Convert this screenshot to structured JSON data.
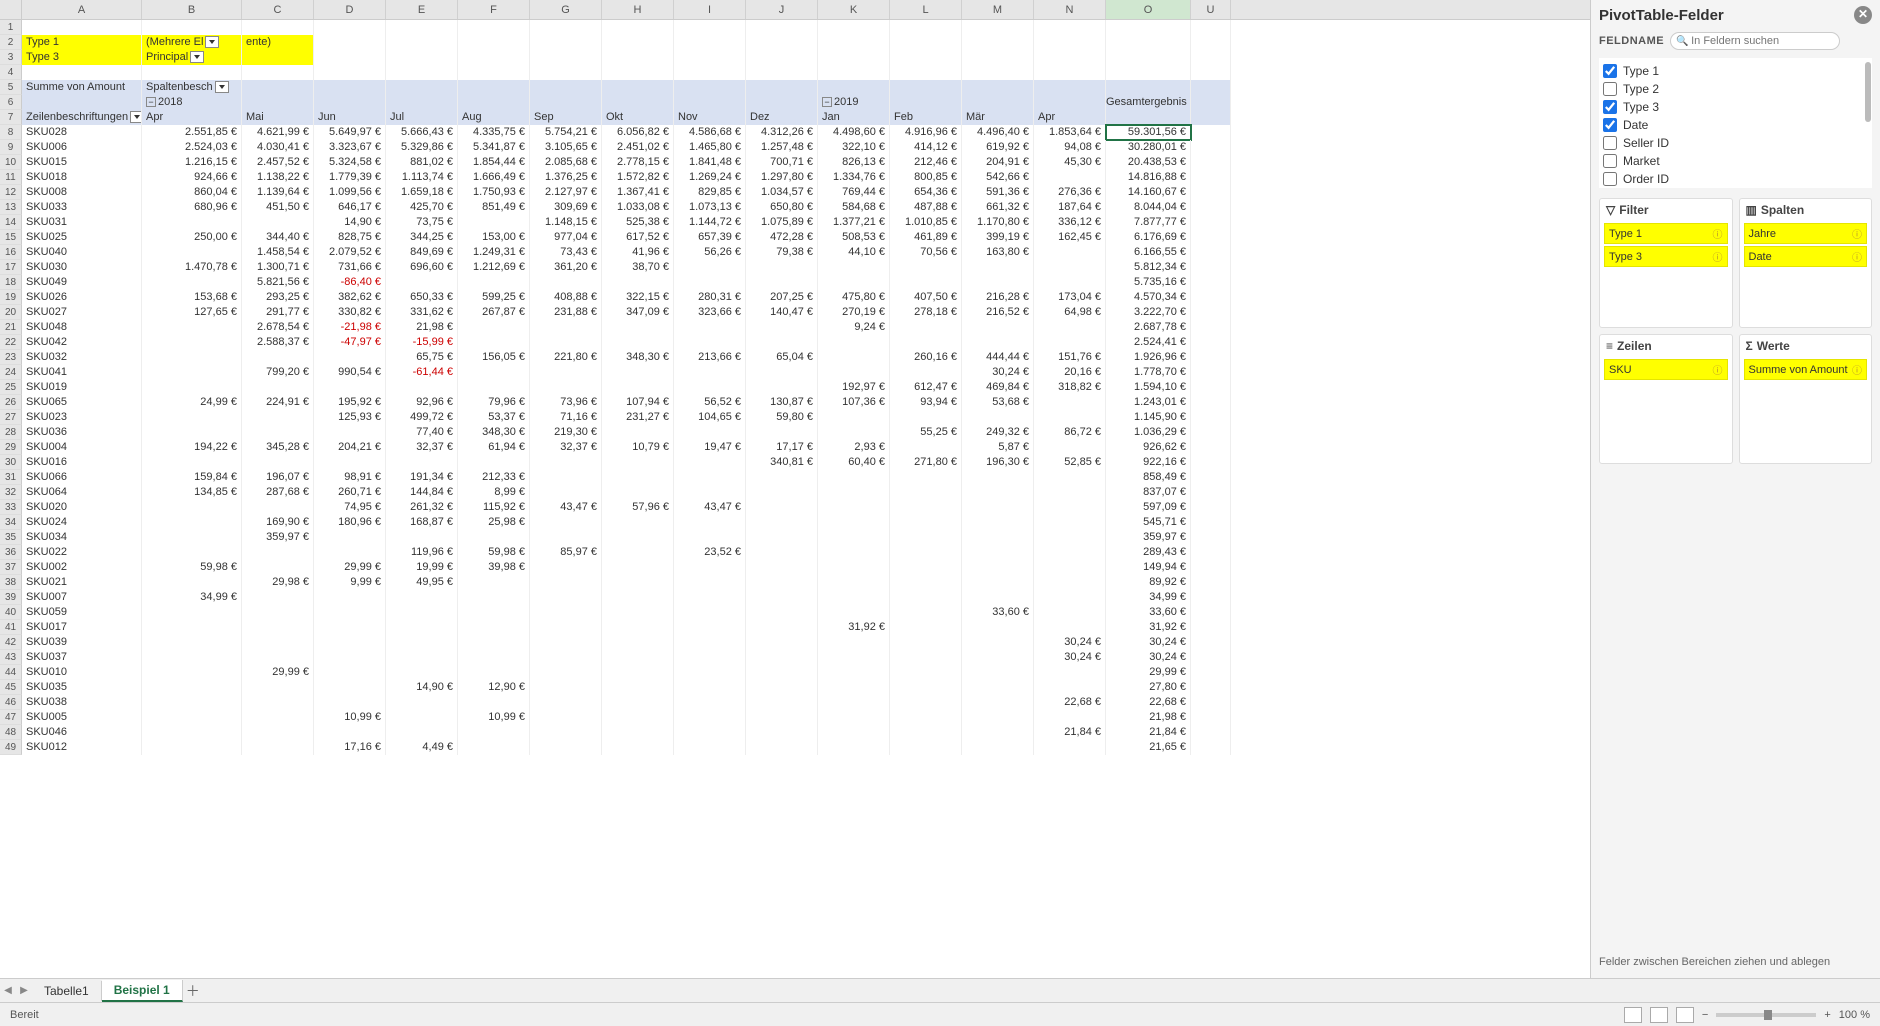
{
  "panel": {
    "title": "PivotTable-Felder",
    "feldname": "FELDNAME",
    "searchPlaceholder": "In Feldern suchen",
    "fields": [
      {
        "label": "Type 1",
        "checked": true
      },
      {
        "label": "Type 2",
        "checked": false
      },
      {
        "label": "Type 3",
        "checked": true
      },
      {
        "label": "Date",
        "checked": true
      },
      {
        "label": "Seller ID",
        "checked": false
      },
      {
        "label": "Market",
        "checked": false
      },
      {
        "label": "Order ID",
        "checked": false
      }
    ],
    "filter": "Filter",
    "spalten": "Spalten",
    "zeilen": "Zeilen",
    "werte": "Werte",
    "filterItems": [
      "Type 1",
      "Type 3"
    ],
    "spaltenItems": [
      "Jahre",
      "Date"
    ],
    "zeilenItems": [
      "SKU"
    ],
    "werteItems": [
      "Summe von Amount"
    ],
    "dragHint": "Felder zwischen Bereichen ziehen und ablegen"
  },
  "tabs": {
    "tab1": "Tabelle1",
    "tab2": "Beispiel 1"
  },
  "status": {
    "ready": "Bereit",
    "zoom": "100 %"
  },
  "columns": [
    "A",
    "B",
    "C",
    "D",
    "E",
    "F",
    "G",
    "H",
    "I",
    "J",
    "K",
    "L",
    "M",
    "N",
    "O",
    "U"
  ],
  "filterRows": {
    "r2": {
      "A": "Type 1",
      "B": "(Mehrere El",
      "C": "ente)"
    },
    "r3": {
      "A": "Type 3",
      "B": "Principal"
    }
  },
  "pivotHdr": {
    "r5A": "Summe von Amount",
    "r5B": "Spaltenbesch",
    "r6B": "2018",
    "r6K": "2019",
    "r6O": "Gesamtergebnis",
    "r7A": "Zeilenbeschriftungen",
    "months": [
      "Apr",
      "Mai",
      "Jun",
      "Jul",
      "Aug",
      "Sep",
      "Okt",
      "Nov",
      "Dez",
      "Jan",
      "Feb",
      "Mär",
      "Apr"
    ]
  },
  "selectedCell": "59.301,56 €",
  "rows": [
    {
      "n": 8,
      "sku": "SKU028",
      "v": [
        "2.551,85 €",
        "4.621,99 €",
        "5.649,97 €",
        "5.666,43 €",
        "4.335,75 €",
        "5.754,21 €",
        "6.056,82 €",
        "4.586,68 €",
        "4.312,26 €",
        "4.498,60 €",
        "4.916,96 €",
        "4.496,40 €",
        "1.853,64 €"
      ],
      "t": "59.301,56 €"
    },
    {
      "n": 9,
      "sku": "SKU006",
      "v": [
        "2.524,03 €",
        "4.030,41 €",
        "3.323,67 €",
        "5.329,86 €",
        "5.341,87 €",
        "3.105,65 €",
        "2.451,02 €",
        "1.465,80 €",
        "1.257,48 €",
        "322,10 €",
        "414,12 €",
        "619,92 €",
        "94,08 €"
      ],
      "t": "30.280,01 €"
    },
    {
      "n": 10,
      "sku": "SKU015",
      "v": [
        "1.216,15 €",
        "2.457,52 €",
        "5.324,58 €",
        "881,02 €",
        "1.854,44 €",
        "2.085,68 €",
        "2.778,15 €",
        "1.841,48 €",
        "700,71 €",
        "826,13 €",
        "212,46 €",
        "204,91 €",
        "45,30 €"
      ],
      "t": "20.438,53 €"
    },
    {
      "n": 11,
      "sku": "SKU018",
      "v": [
        "924,66 €",
        "1.138,22 €",
        "1.779,39 €",
        "1.113,74 €",
        "1.666,49 €",
        "1.376,25 €",
        "1.572,82 €",
        "1.269,24 €",
        "1.297,80 €",
        "1.334,76 €",
        "800,85 €",
        "542,66 €",
        ""
      ],
      "t": "14.816,88 €"
    },
    {
      "n": 12,
      "sku": "SKU008",
      "v": [
        "860,04 €",
        "1.139,64 €",
        "1.099,56 €",
        "1.659,18 €",
        "1.750,93 €",
        "2.127,97 €",
        "1.367,41 €",
        "829,85 €",
        "1.034,57 €",
        "769,44 €",
        "654,36 €",
        "591,36 €",
        "276,36 €"
      ],
      "t": "14.160,67 €"
    },
    {
      "n": 13,
      "sku": "SKU033",
      "v": [
        "680,96 €",
        "451,50 €",
        "646,17 €",
        "425,70 €",
        "851,49 €",
        "309,69 €",
        "1.033,08 €",
        "1.073,13 €",
        "650,80 €",
        "584,68 €",
        "487,88 €",
        "661,32 €",
        "187,64 €"
      ],
      "t": "8.044,04 €"
    },
    {
      "n": 14,
      "sku": "SKU031",
      "v": [
        "",
        "",
        "14,90 €",
        "73,75 €",
        "",
        "1.148,15 €",
        "525,38 €",
        "1.144,72 €",
        "1.075,89 €",
        "1.377,21 €",
        "1.010,85 €",
        "1.170,80 €",
        "336,12 €"
      ],
      "t": "7.877,77 €"
    },
    {
      "n": 15,
      "sku": "SKU025",
      "v": [
        "250,00 €",
        "344,40 €",
        "828,75 €",
        "344,25 €",
        "153,00 €",
        "977,04 €",
        "617,52 €",
        "657,39 €",
        "472,28 €",
        "508,53 €",
        "461,89 €",
        "399,19 €",
        "162,45 €"
      ],
      "t": "6.176,69 €"
    },
    {
      "n": 16,
      "sku": "SKU040",
      "v": [
        "",
        "1.458,54 €",
        "2.079,52 €",
        "849,69 €",
        "1.249,31 €",
        "73,43 €",
        "41,96 €",
        "56,26 €",
        "79,38 €",
        "44,10 €",
        "70,56 €",
        "163,80 €",
        ""
      ],
      "t": "6.166,55 €"
    },
    {
      "n": 17,
      "sku": "SKU030",
      "v": [
        "1.470,78 €",
        "1.300,71 €",
        "731,66 €",
        "696,60 €",
        "1.212,69 €",
        "361,20 €",
        "38,70 €",
        "",
        "",
        "",
        "",
        "",
        ""
      ],
      "t": "5.812,34 €"
    },
    {
      "n": 18,
      "sku": "SKU049",
      "v": [
        "",
        "5.821,56 €",
        "-86,40 €",
        "",
        "",
        "",
        "",
        "",
        "",
        "",
        "",
        "",
        ""
      ],
      "t": "5.735,16 €"
    },
    {
      "n": 19,
      "sku": "SKU026",
      "v": [
        "153,68 €",
        "293,25 €",
        "382,62 €",
        "650,33 €",
        "599,25 €",
        "408,88 €",
        "322,15 €",
        "280,31 €",
        "207,25 €",
        "475,80 €",
        "407,50 €",
        "216,28 €",
        "173,04 €"
      ],
      "t": "4.570,34 €"
    },
    {
      "n": 20,
      "sku": "SKU027",
      "v": [
        "127,65 €",
        "291,77 €",
        "330,82 €",
        "331,62 €",
        "267,87 €",
        "231,88 €",
        "347,09 €",
        "323,66 €",
        "140,47 €",
        "270,19 €",
        "278,18 €",
        "216,52 €",
        "64,98 €"
      ],
      "t": "3.222,70 €"
    },
    {
      "n": 21,
      "sku": "SKU048",
      "v": [
        "",
        "2.678,54 €",
        "-21,98 €",
        "21,98 €",
        "",
        "",
        "",
        "",
        "",
        "9,24 €",
        "",
        "",
        ""
      ],
      "t": "2.687,78 €"
    },
    {
      "n": 22,
      "sku": "SKU042",
      "v": [
        "",
        "2.588,37 €",
        "-47,97 €",
        "-15,99 €",
        "",
        "",
        "",
        "",
        "",
        "",
        "",
        "",
        ""
      ],
      "t": "2.524,41 €"
    },
    {
      "n": 23,
      "sku": "SKU032",
      "v": [
        "",
        "",
        "",
        "65,75 €",
        "156,05 €",
        "221,80 €",
        "348,30 €",
        "213,66 €",
        "65,04 €",
        "",
        "260,16 €",
        "444,44 €",
        "151,76 €"
      ],
      "t": "1.926,96 €"
    },
    {
      "n": 24,
      "sku": "SKU041",
      "v": [
        "",
        "799,20 €",
        "990,54 €",
        "-61,44 €",
        "",
        "",
        "",
        "",
        "",
        "",
        "",
        "30,24 €",
        "20,16 €"
      ],
      "t": "1.778,70 €"
    },
    {
      "n": 25,
      "sku": "SKU019",
      "v": [
        "",
        "",
        "",
        "",
        "",
        "",
        "",
        "",
        "",
        "192,97 €",
        "612,47 €",
        "469,84 €",
        "318,82 €"
      ],
      "t": "1.594,10 €"
    },
    {
      "n": 26,
      "sku": "SKU065",
      "v": [
        "24,99 €",
        "224,91 €",
        "195,92 €",
        "92,96 €",
        "79,96 €",
        "73,96 €",
        "107,94 €",
        "56,52 €",
        "130,87 €",
        "107,36 €",
        "93,94 €",
        "53,68 €",
        ""
      ],
      "t": "1.243,01 €"
    },
    {
      "n": 27,
      "sku": "SKU023",
      "v": [
        "",
        "",
        "125,93 €",
        "499,72 €",
        "53,37 €",
        "71,16 €",
        "231,27 €",
        "104,65 €",
        "59,80 €",
        "",
        "",
        "",
        ""
      ],
      "t": "1.145,90 €"
    },
    {
      "n": 28,
      "sku": "SKU036",
      "v": [
        "",
        "",
        "",
        "77,40 €",
        "348,30 €",
        "219,30 €",
        "",
        "",
        "",
        "",
        "55,25 €",
        "249,32 €",
        "86,72 €"
      ],
      "t": "1.036,29 €"
    },
    {
      "n": 29,
      "sku": "SKU004",
      "v": [
        "194,22 €",
        "345,28 €",
        "204,21 €",
        "32,37 €",
        "61,94 €",
        "32,37 €",
        "10,79 €",
        "19,47 €",
        "17,17 €",
        "2,93 €",
        "",
        "5,87 €",
        ""
      ],
      "t": "926,62 €"
    },
    {
      "n": 30,
      "sku": "SKU016",
      "v": [
        "",
        "",
        "",
        "",
        "",
        "",
        "",
        "",
        "340,81 €",
        "60,40 €",
        "271,80 €",
        "196,30 €",
        "52,85 €"
      ],
      "t": "922,16 €"
    },
    {
      "n": 31,
      "sku": "SKU066",
      "v": [
        "159,84 €",
        "196,07 €",
        "98,91 €",
        "191,34 €",
        "212,33 €",
        "",
        "",
        "",
        "",
        "",
        "",
        "",
        ""
      ],
      "t": "858,49 €"
    },
    {
      "n": 32,
      "sku": "SKU064",
      "v": [
        "134,85 €",
        "287,68 €",
        "260,71 €",
        "144,84 €",
        "8,99 €",
        "",
        "",
        "",
        "",
        "",
        "",
        "",
        ""
      ],
      "t": "837,07 €"
    },
    {
      "n": 33,
      "sku": "SKU020",
      "v": [
        "",
        "",
        "74,95 €",
        "261,32 €",
        "115,92 €",
        "43,47 €",
        "57,96 €",
        "43,47 €",
        "",
        "",
        "",
        "",
        ""
      ],
      "t": "597,09 €"
    },
    {
      "n": 34,
      "sku": "SKU024",
      "v": [
        "",
        "169,90 €",
        "180,96 €",
        "168,87 €",
        "25,98 €",
        "",
        "",
        "",
        "",
        "",
        "",
        "",
        ""
      ],
      "t": "545,71 €"
    },
    {
      "n": 35,
      "sku": "SKU034",
      "v": [
        "",
        "359,97 €",
        "",
        "",
        "",
        "",
        "",
        "",
        "",
        "",
        "",
        "",
        ""
      ],
      "t": "359,97 €"
    },
    {
      "n": 36,
      "sku": "SKU022",
      "v": [
        "",
        "",
        "",
        "119,96 €",
        "59,98 €",
        "85,97 €",
        "",
        "23,52 €",
        "",
        "",
        "",
        "",
        ""
      ],
      "t": "289,43 €"
    },
    {
      "n": 37,
      "sku": "SKU002",
      "v": [
        "59,98 €",
        "",
        "29,99 €",
        "19,99 €",
        "39,98 €",
        "",
        "",
        "",
        "",
        "",
        "",
        "",
        ""
      ],
      "t": "149,94 €"
    },
    {
      "n": 38,
      "sku": "SKU021",
      "v": [
        "",
        "29,98 €",
        "9,99 €",
        "49,95 €",
        "",
        "",
        "",
        "",
        "",
        "",
        "",
        "",
        ""
      ],
      "t": "89,92 €"
    },
    {
      "n": 39,
      "sku": "SKU007",
      "v": [
        "34,99 €",
        "",
        "",
        "",
        "",
        "",
        "",
        "",
        "",
        "",
        "",
        "",
        ""
      ],
      "t": "34,99 €"
    },
    {
      "n": 40,
      "sku": "SKU059",
      "v": [
        "",
        "",
        "",
        "",
        "",
        "",
        "",
        "",
        "",
        "",
        "",
        "33,60 €",
        ""
      ],
      "t": "33,60 €"
    },
    {
      "n": 41,
      "sku": "SKU017",
      "v": [
        "",
        "",
        "",
        "",
        "",
        "",
        "",
        "",
        "",
        "31,92 €",
        "",
        "",
        ""
      ],
      "t": "31,92 €"
    },
    {
      "n": 42,
      "sku": "SKU039",
      "v": [
        "",
        "",
        "",
        "",
        "",
        "",
        "",
        "",
        "",
        "",
        "",
        "",
        "30,24 €"
      ],
      "t": "30,24 €"
    },
    {
      "n": 43,
      "sku": "SKU037",
      "v": [
        "",
        "",
        "",
        "",
        "",
        "",
        "",
        "",
        "",
        "",
        "",
        "",
        "30,24 €"
      ],
      "t": "30,24 €"
    },
    {
      "n": 44,
      "sku": "SKU010",
      "v": [
        "",
        "29,99 €",
        "",
        "",
        "",
        "",
        "",
        "",
        "",
        "",
        "",
        "",
        ""
      ],
      "t": "29,99 €"
    },
    {
      "n": 45,
      "sku": "SKU035",
      "v": [
        "",
        "",
        "",
        "14,90 €",
        "12,90 €",
        "",
        "",
        "",
        "",
        "",
        "",
        "",
        ""
      ],
      "t": "27,80 €"
    },
    {
      "n": 46,
      "sku": "SKU038",
      "v": [
        "",
        "",
        "",
        "",
        "",
        "",
        "",
        "",
        "",
        "",
        "",
        "",
        "22,68 €"
      ],
      "t": "22,68 €"
    },
    {
      "n": 47,
      "sku": "SKU005",
      "v": [
        "",
        "",
        "10,99 €",
        "",
        "10,99 €",
        "",
        "",
        "",
        "",
        "",
        "",
        "",
        ""
      ],
      "t": "21,98 €"
    },
    {
      "n": 48,
      "sku": "SKU046",
      "v": [
        "",
        "",
        "",
        "",
        "",
        "",
        "",
        "",
        "",
        "",
        "",
        "",
        "21,84 €"
      ],
      "t": "21,84 €"
    },
    {
      "n": 49,
      "sku": "SKU012",
      "v": [
        "",
        "",
        "17,16 €",
        "4,49 €",
        "",
        "",
        "",
        "",
        "",
        "",
        "",
        "",
        ""
      ],
      "t": "21,65 €"
    }
  ]
}
